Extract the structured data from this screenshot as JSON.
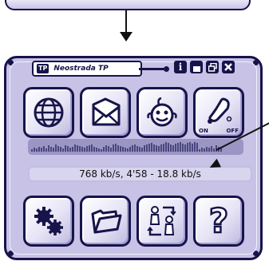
{
  "window": {
    "title": "Neostrada TP",
    "logo_text": "TP"
  },
  "title_buttons": [
    {
      "icon": "info-icon",
      "symbol": "i"
    },
    {
      "icon": "minimize-icon"
    },
    {
      "icon": "restore-icon"
    },
    {
      "icon": "close-icon"
    }
  ],
  "main_buttons_top": [
    {
      "icon": "globe-icon"
    },
    {
      "icon": "mail-icon"
    },
    {
      "icon": "smiley-face-icon"
    },
    {
      "icon": "power-toggle-icon",
      "on_label": "ON",
      "off_label": "OFF"
    }
  ],
  "main_buttons_bottom": [
    {
      "icon": "gears-icon"
    },
    {
      "icon": "folder-icon"
    },
    {
      "icon": "user-swap-icon"
    },
    {
      "icon": "help-icon",
      "symbol": "?"
    }
  ],
  "status": {
    "text": "768 kb/s, 4'58 - 18.8 kb/s"
  },
  "colors": {
    "frame": "#16144a",
    "body": "#c8c2e6",
    "meter": "#9a95c2",
    "status_bg": "#d8d5ee"
  }
}
